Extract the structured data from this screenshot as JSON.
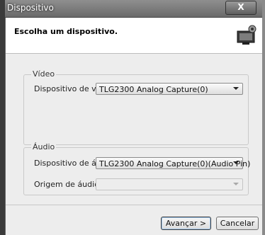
{
  "window": {
    "title": "Dispositivo",
    "close_label": "X"
  },
  "header": {
    "title": "Escolha um dispositivo.",
    "icon": "device-settings-icon"
  },
  "video": {
    "group_label": "Vídeo",
    "device_label": "Dispositivo de vídeo:",
    "device_value": "TLG2300 Analog Capture(0)"
  },
  "audio": {
    "group_label": "Áudio",
    "device_label": "Dispositivo de áudio:",
    "device_value": "TLG2300 Analog Capture(0)(Audio Pin)",
    "source_label": "Origem de áudio:",
    "source_value": ""
  },
  "buttons": {
    "next": "Avançar >",
    "cancel": "Cancelar"
  }
}
